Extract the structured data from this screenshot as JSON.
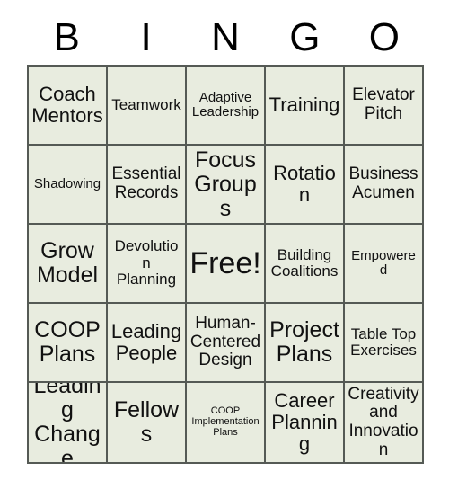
{
  "card": {
    "title": "BINGO",
    "header_letters": [
      "B",
      "I",
      "N",
      "G",
      "O"
    ],
    "colors": {
      "cell_background": "#e8ecdf",
      "grid_border": "#555a55",
      "text": "#111111",
      "page_background": "#ffffff"
    },
    "rows": [
      [
        {
          "label": "Coach Mentors",
          "size": "lg"
        },
        {
          "label": "Teamwork",
          "size": "sm"
        },
        {
          "label": "Adaptive Leadership",
          "size": "xs"
        },
        {
          "label": "Training",
          "size": "lg"
        },
        {
          "label": "Elevator Pitch",
          "size": "md"
        }
      ],
      [
        {
          "label": "Shadowing",
          "size": "xs"
        },
        {
          "label": "Essential Records",
          "size": "md"
        },
        {
          "label": "Focus Groups",
          "size": "xl"
        },
        {
          "label": "Rotation",
          "size": "lg"
        },
        {
          "label": "Business Acumen",
          "size": "md"
        }
      ],
      [
        {
          "label": "Grow Model",
          "size": "xl"
        },
        {
          "label": "Devolution Planning",
          "size": "sm"
        },
        {
          "label": "Free!",
          "size": "xxl"
        },
        {
          "label": "Building Coalitions",
          "size": "sm"
        },
        {
          "label": "Empowered",
          "size": "xs"
        }
      ],
      [
        {
          "label": "COOP Plans",
          "size": "xl"
        },
        {
          "label": "Leading People",
          "size": "lg"
        },
        {
          "label": "Human-Centered Design",
          "size": "md"
        },
        {
          "label": "Project Plans",
          "size": "xl"
        },
        {
          "label": "Table Top Exercises",
          "size": "sm"
        }
      ],
      [
        {
          "label": "Leading Change",
          "size": "xl"
        },
        {
          "label": "Fellows",
          "size": "xl"
        },
        {
          "label": "COOP Implementation Plans",
          "size": "xxs"
        },
        {
          "label": "Career Planning",
          "size": "lg"
        },
        {
          "label": "Creativity and Innovation",
          "size": "md"
        }
      ]
    ]
  }
}
